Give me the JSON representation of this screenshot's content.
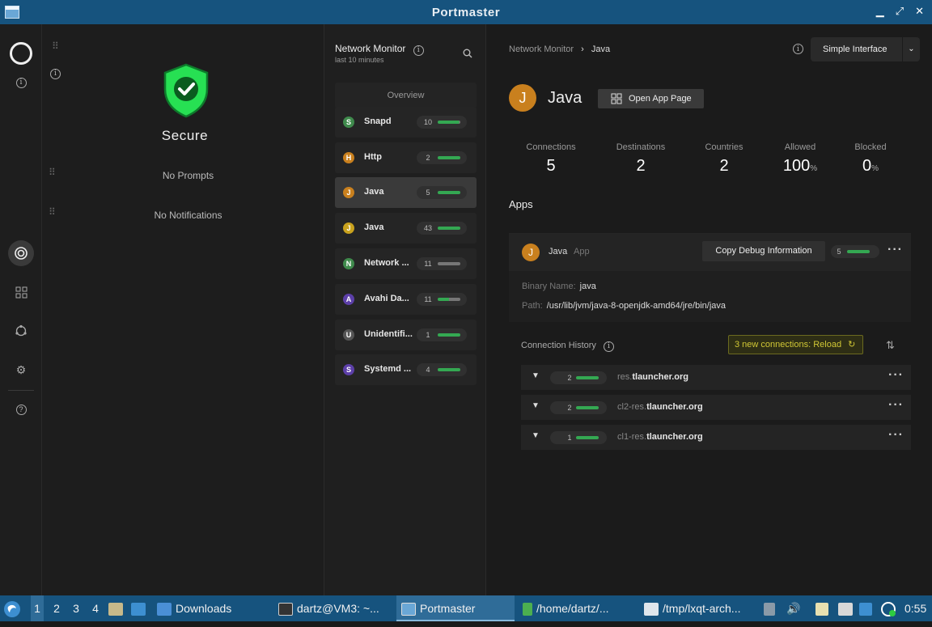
{
  "window": {
    "title": "Portmaster"
  },
  "dashboard": {
    "status": "Secure",
    "prompts": "No Prompts",
    "notifications": "No Notifications"
  },
  "monitor": {
    "title": "Network Monitor",
    "subtitle": "last 10 minutes",
    "overview": "Overview",
    "items": [
      {
        "initial": "S",
        "name": "Snapd",
        "count": "10",
        "color": "#3f8a4c",
        "level": 0.95
      },
      {
        "initial": "H",
        "name": "Http",
        "count": "2",
        "color": "#c9801e",
        "level": 1.0
      },
      {
        "initial": "J",
        "name": "Java",
        "count": "5",
        "color": "#c9801e",
        "level": 1.0
      },
      {
        "initial": "J",
        "name": "Java",
        "count": "43",
        "color": "#c9a21e",
        "level": 1.0
      },
      {
        "initial": "N",
        "name": "Network ...",
        "count": "11",
        "color": "#3f8a4c",
        "level": 0.0
      },
      {
        "initial": "A",
        "name": "Avahi Da...",
        "count": "11",
        "color": "#5c3fa8",
        "level": 0.5
      },
      {
        "initial": "U",
        "name": "Unidentifi...",
        "count": "1",
        "color": "#555555",
        "level": 1.0
      },
      {
        "initial": "S",
        "name": "Systemd ...",
        "count": "4",
        "color": "#5c3fa8",
        "level": 1.0
      }
    ]
  },
  "detail": {
    "breadcrumb_root": "Network Monitor",
    "breadcrumb_current": "Java",
    "mode_button": "Simple Interface",
    "app_initial": "J",
    "app_name": "Java",
    "open_app_page": "Open App Page",
    "stats": [
      {
        "label": "Connections",
        "value": "5",
        "unit": ""
      },
      {
        "label": "Destinations",
        "value": "2",
        "unit": ""
      },
      {
        "label": "Countries",
        "value": "2",
        "unit": ""
      },
      {
        "label": "Allowed",
        "value": "100",
        "unit": "%"
      },
      {
        "label": "Blocked",
        "value": "0",
        "unit": "%"
      }
    ],
    "apps_heading": "Apps",
    "card": {
      "name": "Java",
      "tag": "App",
      "copy_debug": "Copy Debug Information",
      "count": "5",
      "binary_label": "Binary Name:",
      "binary_value": "java",
      "path_label": "Path:",
      "path_value": "/usr/lib/jvm/java-8-openjdk-amd64/jre/bin/java"
    },
    "history_title": "Connection History",
    "reload_text": "3 new connections: Reload",
    "history": [
      {
        "count": "2",
        "prefix": "res.",
        "domain": "tlauncher.org"
      },
      {
        "count": "2",
        "prefix": "cl2-res.",
        "domain": "tlauncher.org"
      },
      {
        "count": "1",
        "prefix": "cl1-res.",
        "domain": "tlauncher.org"
      }
    ]
  },
  "taskbar": {
    "desktops": [
      "1",
      "2",
      "3",
      "4"
    ],
    "downloads": "Downloads",
    "terminal": "dartz@VM3: ~...",
    "portmaster": "Portmaster",
    "home": "/home/dartz/...",
    "tmp": "/tmp/lxqt-arch...",
    "clock": "0:55"
  }
}
